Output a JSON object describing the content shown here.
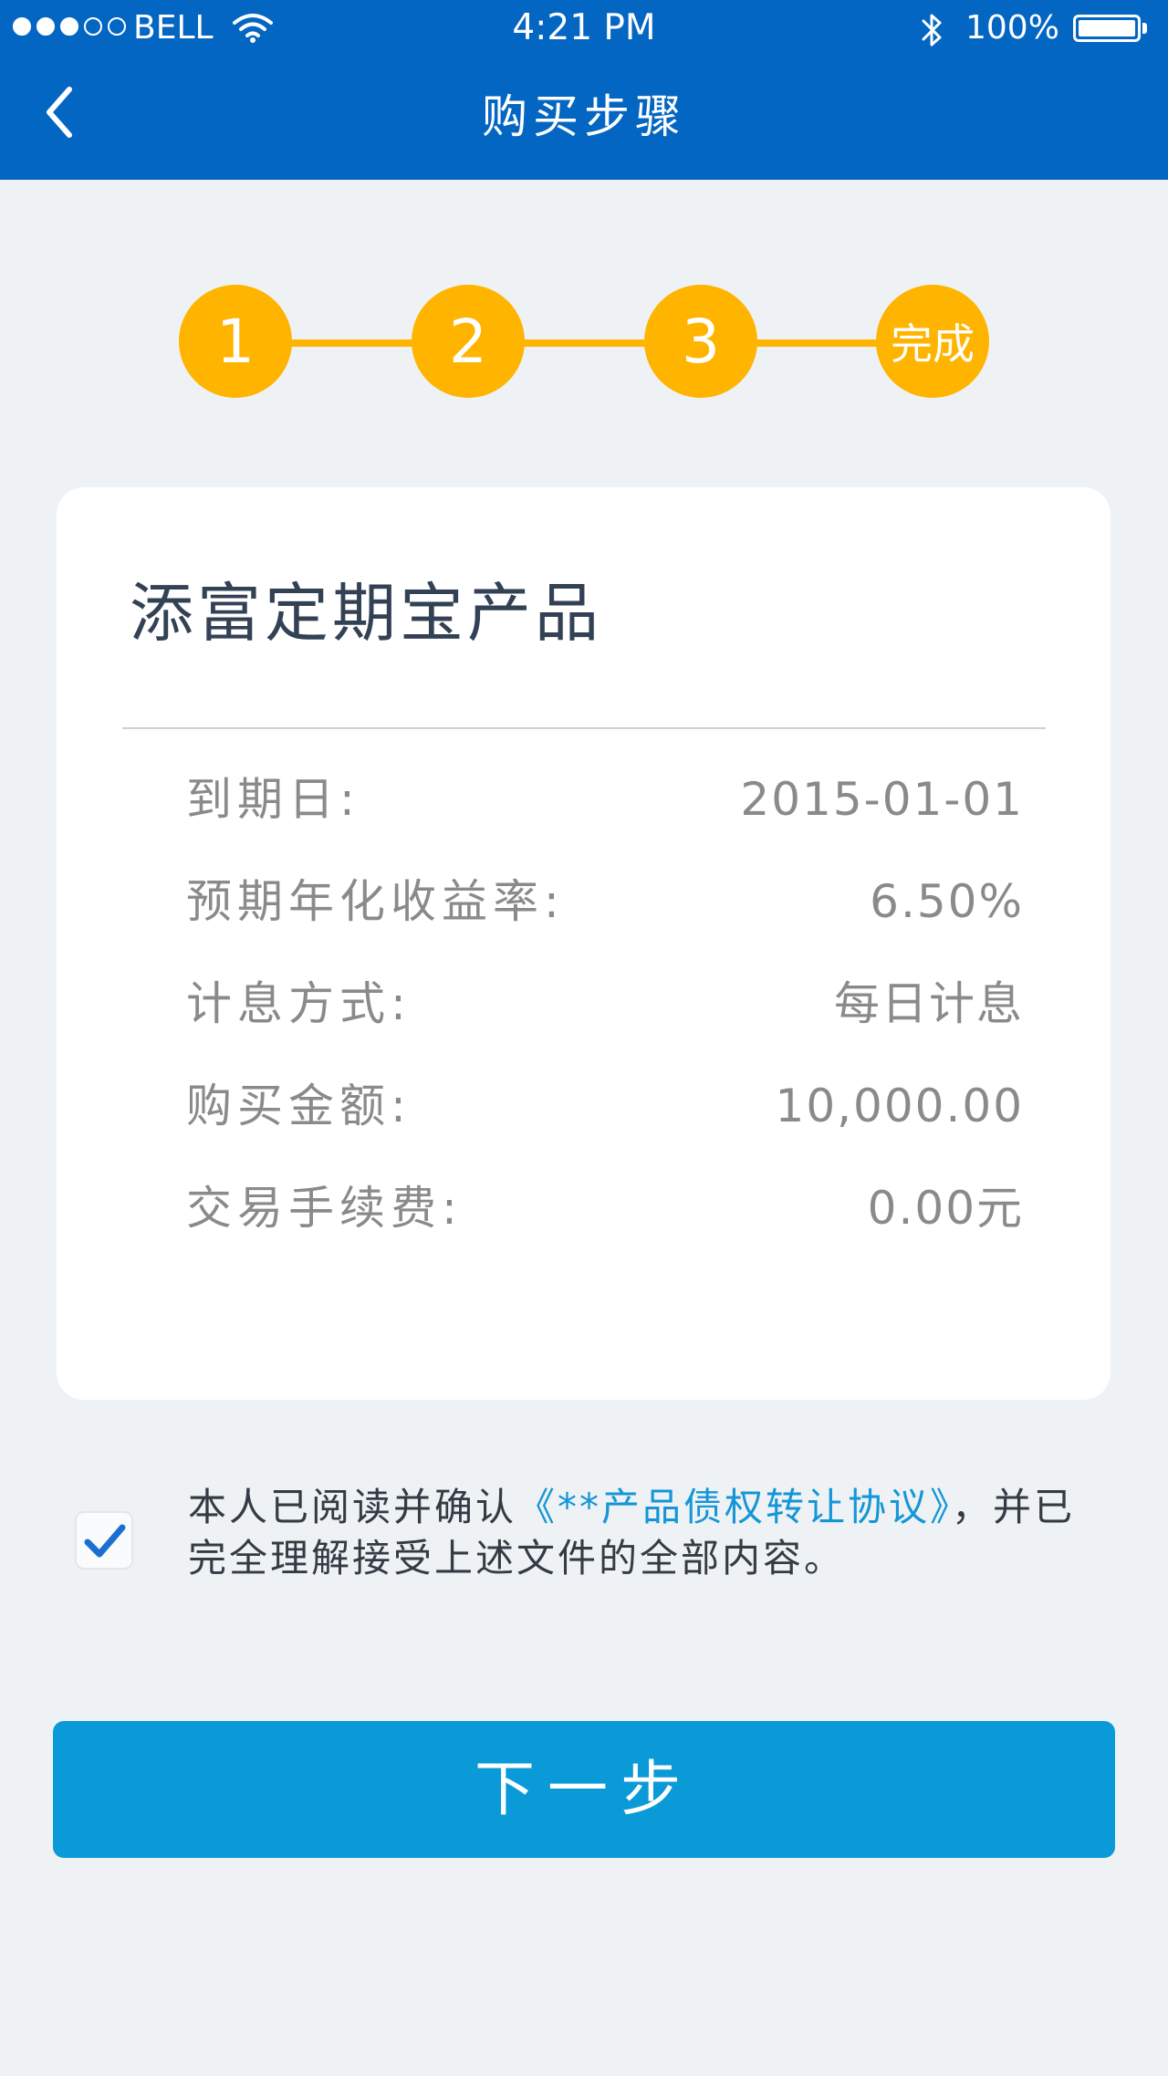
{
  "status_bar": {
    "carrier": "BELL",
    "time": "4:21 PM",
    "battery": "100%",
    "signal_filled": 3,
    "signal_total": 5
  },
  "nav": {
    "title": "购买步骤"
  },
  "stepper": {
    "steps": [
      "1",
      "2",
      "3",
      "完成"
    ]
  },
  "product": {
    "title": "添富定期宝产品",
    "rows": [
      {
        "label": "到期日:",
        "value": "2015-01-01"
      },
      {
        "label": "预期年化收益率:",
        "value": "6.50%"
      },
      {
        "label": "计息方式:",
        "value": "每日计息"
      },
      {
        "label": "购买金额:",
        "value": "10,000.00"
      },
      {
        "label": "交易手续费:",
        "value": "0.00元"
      }
    ]
  },
  "agreement": {
    "checked": true,
    "text_before": "本人已阅读并确认",
    "link": "《**产品债权转让协议》",
    "text_after": "，并已完全理解接受上述文件的全部内容。"
  },
  "next_button": {
    "label": "下一步"
  },
  "colors": {
    "header": "#0466c3",
    "step": "#ffb400",
    "button": "#0a9ad8",
    "link": "#1596d6",
    "background": "#eff2f5"
  }
}
